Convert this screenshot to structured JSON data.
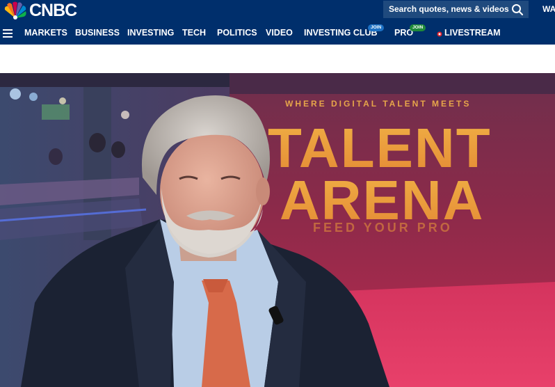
{
  "brand": {
    "name": "CNBC",
    "logo_icon": "peacock-icon",
    "colors": {
      "header_bg": "#002f6c",
      "search_bg": "#1f4a7e",
      "join_blue": "#1d71c4",
      "join_green": "#1f8a3a",
      "live_red": "#e0242f"
    }
  },
  "search": {
    "placeholder": "Search quotes, news & videos",
    "icon": "search-icon"
  },
  "header_cut_link": "WA",
  "nav": {
    "menu_icon": "hamburger-icon",
    "items": [
      {
        "label": "MARKETS"
      },
      {
        "label": "BUSINESS"
      },
      {
        "label": "INVESTING"
      },
      {
        "label": "TECH"
      },
      {
        "label": "POLITICS"
      },
      {
        "label": "VIDEO"
      },
      {
        "label": "INVESTING CLUB",
        "badge": "JOIN"
      },
      {
        "label": "PRO",
        "badge": "JOIN"
      },
      {
        "label": "LIVESTREAM",
        "icon": "live-dot-icon"
      }
    ]
  },
  "video": {
    "backdrop_lines": [
      "WHERE DIGITAL TALENT MEETS",
      "TALENT",
      "ARENA",
      "FEED YOUR PRO"
    ]
  }
}
